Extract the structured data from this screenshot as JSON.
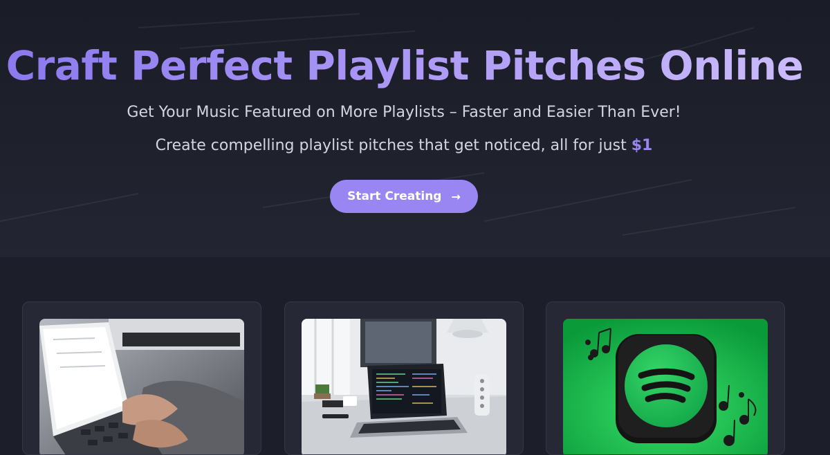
{
  "hero": {
    "title": "Craft Perfect Playlist Pitches Online",
    "subtitle": "Get Your Music Featured on More Playlists – Faster and Easier Than Ever!",
    "tagline_prefix": "Create compelling playlist pitches that get noticed, all for just ",
    "tagline_price": "$1",
    "cta_label": "Start Creating",
    "cta_icon": "arrow-right-icon"
  },
  "cards": [
    {
      "image": "laptop-typing-photo"
    },
    {
      "image": "laptop-desk-code-photo"
    },
    {
      "image": "spotify-logo-music-notes-image"
    }
  ],
  "colors": {
    "background": "#1c1e2a",
    "accent": "#9a86f2",
    "card": "#262835",
    "spotify_green": "#1db954"
  }
}
